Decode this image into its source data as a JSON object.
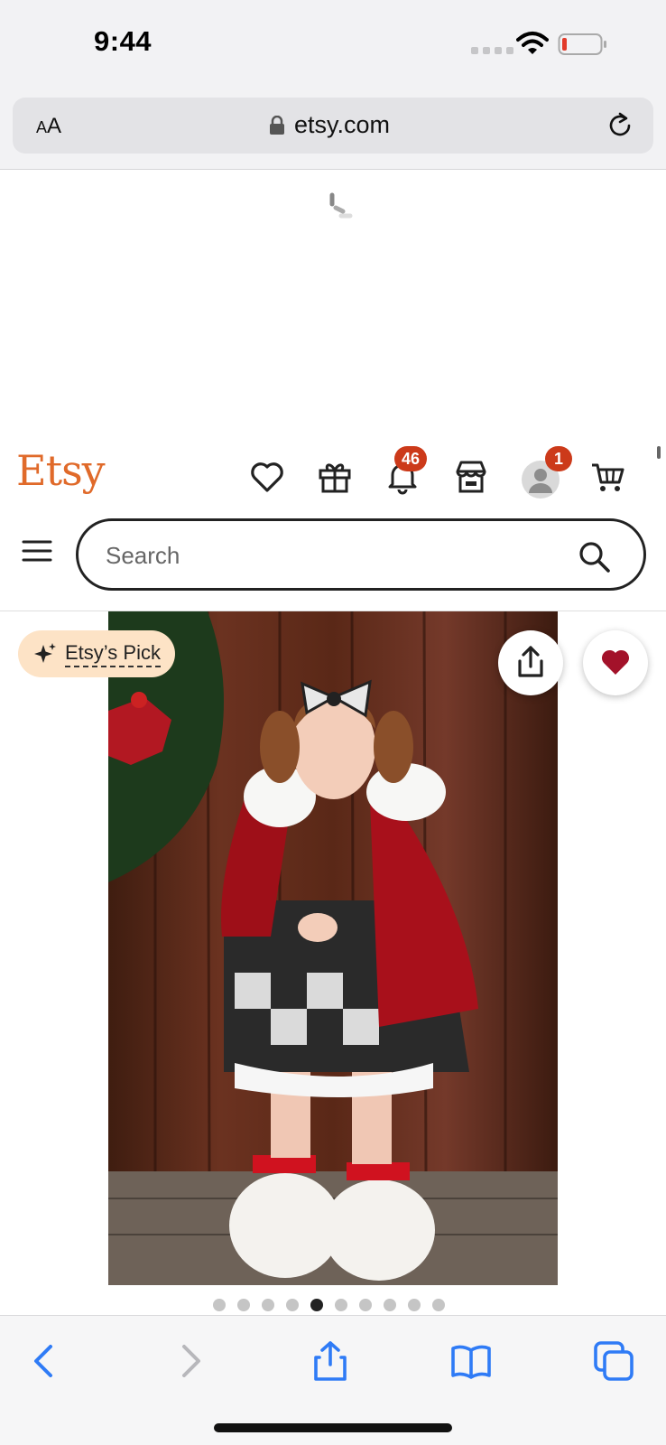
{
  "status_bar": {
    "time": "9:44"
  },
  "browser": {
    "text_size_label": "AA",
    "url": "etsy.com"
  },
  "header": {
    "logo": "Etsy",
    "notifications_badge": "46",
    "account_badge": "1",
    "brand_color": "#e06a2a",
    "badge_color": "#cc3a1a"
  },
  "search": {
    "placeholder": "Search"
  },
  "listing": {
    "pick_label": "Etsy’s Pick",
    "favorite_color": "#a3122a",
    "carousel": {
      "total": 10,
      "active_index": 4
    }
  },
  "icons": {
    "header": [
      "heart-icon",
      "gift-icon",
      "bell-icon",
      "shop-icon",
      "avatar",
      "cart-icon"
    ],
    "toolbar": [
      "back-icon",
      "forward-icon",
      "share-icon",
      "bookmarks-icon",
      "tabs-icon"
    ]
  }
}
